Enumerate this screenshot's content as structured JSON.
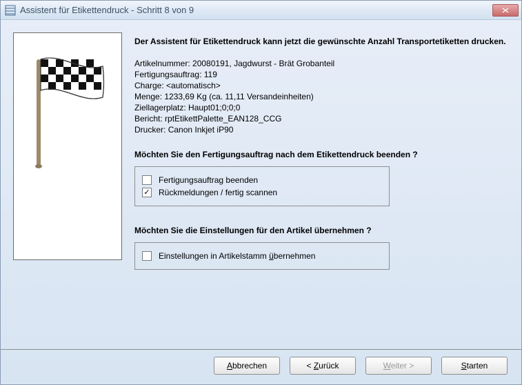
{
  "titlebar": {
    "title": "Assistent für Etikettendruck - Schritt 8 von 9"
  },
  "intro": "Der Assistent für Etikettendruck kann jetzt die gewünschte Anzahl Transportetiketten drucken.",
  "info": {
    "artikelnummer_label": "Artikelnummer",
    "artikelnummer_value": "20080191, Jagdwurst - Brät Grobanteil",
    "fertigungsauftrag_label": "Fertigungsauftrag",
    "fertigungsauftrag_value": "119",
    "charge_label": "Charge",
    "charge_value": "<automatisch>",
    "menge_label": "Menge",
    "menge_value": "1233,69 Kg (ca. 11,11 Versandeinheiten)",
    "ziellagerplatz_label": "Ziellagerplatz",
    "ziellagerplatz_value": "Haupt01;0;0;0",
    "bericht_label": "Bericht",
    "bericht_value": "rptEtikettPalette_EAN128_CCG",
    "drucker_label": "Drucker",
    "drucker_value": "Canon Inkjet iP90"
  },
  "question1": "Möchten Sie den Fertigungsauftrag nach dem Etikettendruck beenden ?",
  "checkbox1_label": "Fertigungsauftrag beenden",
  "checkbox2_label": "Rückmeldungen / fertig scannen",
  "question2": "Möchten Sie die Einstellungen für den Artikel übernehmen ?",
  "checkbox3_prefix": "Einstellungen in Artikelstamm ",
  "checkbox3_under": "ü",
  "checkbox3_rest": "bernehmen",
  "buttons": {
    "cancel_under": "A",
    "cancel_rest": "bbrechen",
    "back_prefix": "< ",
    "back_under": "Z",
    "back_rest": "urück",
    "next_under": "W",
    "next_rest": "eiter >",
    "start_under": "S",
    "start_rest": "tarten"
  }
}
